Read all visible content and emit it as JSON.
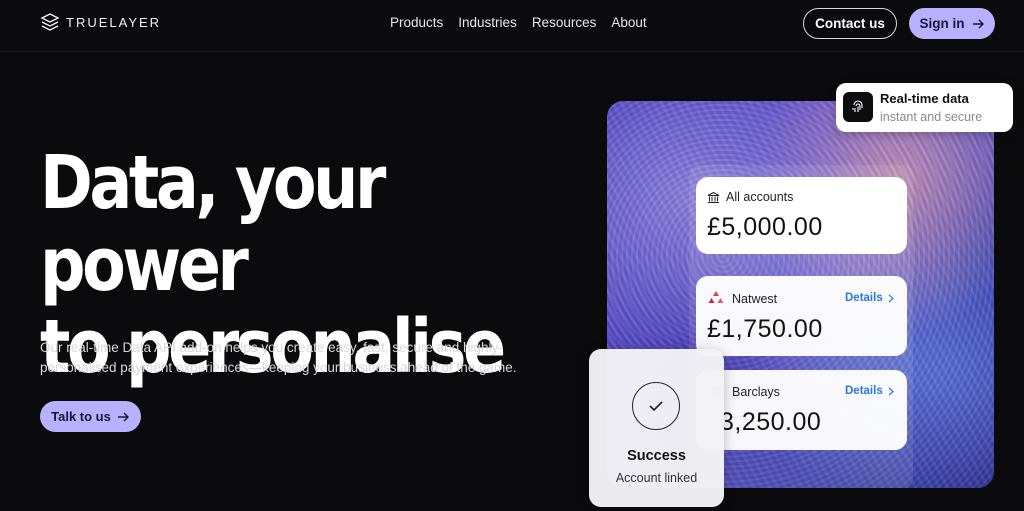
{
  "header": {
    "logo_text": "TRUELAYER",
    "nav": [
      "Products",
      "Industries",
      "Resources",
      "About"
    ],
    "contact_label": "Contact us",
    "signin_label": "Sign in"
  },
  "hero": {
    "title_line1": "Data, your power",
    "title_line2": "to personalise",
    "subtitle_line1": "Our real-time Data API add-on helps you create easy, fast, secure and highly-",
    "subtitle_line2": "personalised payment experiences—keeping your business ahead of the game.",
    "cta_label": "Talk to us"
  },
  "visual": {
    "badge": {
      "title": "Real-time data",
      "subtitle": "instant and secure"
    },
    "accounts": [
      {
        "label": "All accounts",
        "amount": "£5,000.00",
        "icon": "bank-icon"
      },
      {
        "label": "Natwest",
        "amount": "£1,750.00",
        "details": "Details",
        "icon": "natwest-logo-icon"
      },
      {
        "label": "Barclays",
        "amount": "3,250.00",
        "details": "Details",
        "icon": "barclays-logo-icon"
      }
    ],
    "success": {
      "title": "Success",
      "subtitle": "Account linked"
    }
  },
  "colors": {
    "background": "#0b0a0c",
    "accent": "#b7b1ff",
    "link": "#2a7bd6",
    "natwest": "#e0404a"
  }
}
